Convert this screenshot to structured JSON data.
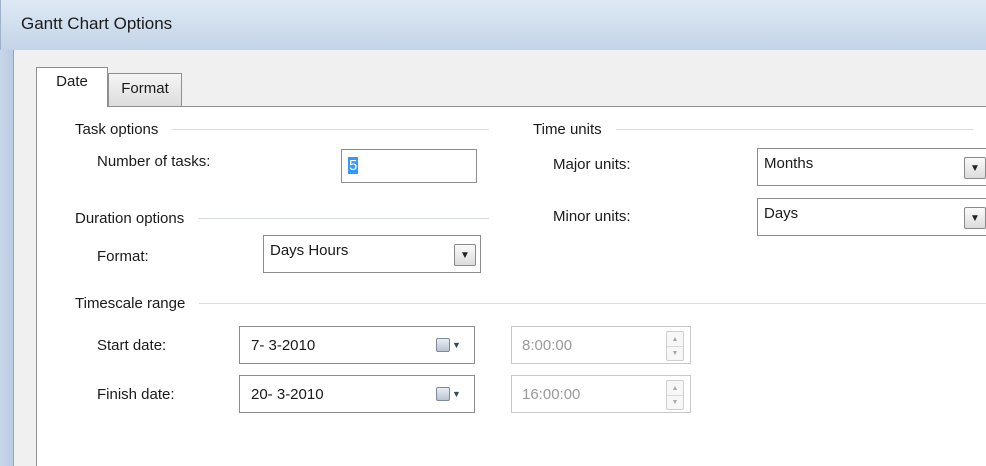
{
  "window": {
    "title": "Gantt Chart Options"
  },
  "tabs": [
    {
      "label": "Date",
      "selected": true
    },
    {
      "label": "Format",
      "selected": false
    }
  ],
  "task_options": {
    "heading": "Task options",
    "num_tasks_label": "Number of tasks:",
    "num_tasks_value": "5"
  },
  "duration_options": {
    "heading": "Duration options",
    "format_label": "Format:",
    "format_value": "Days Hours"
  },
  "time_units": {
    "heading": "Time units",
    "major_label": "Major units:",
    "major_value": "Months",
    "minor_label": "Minor units:",
    "minor_value": "Days"
  },
  "timescale": {
    "heading": "Timescale range",
    "start_label": "Start date:",
    "start_date": "7- 3-2010",
    "start_time": "8:00:00",
    "finish_label": "Finish date:",
    "finish_date": "20- 3-2010",
    "finish_time": "16:00:00"
  },
  "icons": {
    "dropdown": "chevron-down-icon",
    "calendar": "calendar-icon",
    "spin": "spin-arrows-icon"
  },
  "colors": {
    "selection": "#3399ff",
    "titlebar": "#cfdded",
    "disabled_text": "#9a9a9a"
  }
}
